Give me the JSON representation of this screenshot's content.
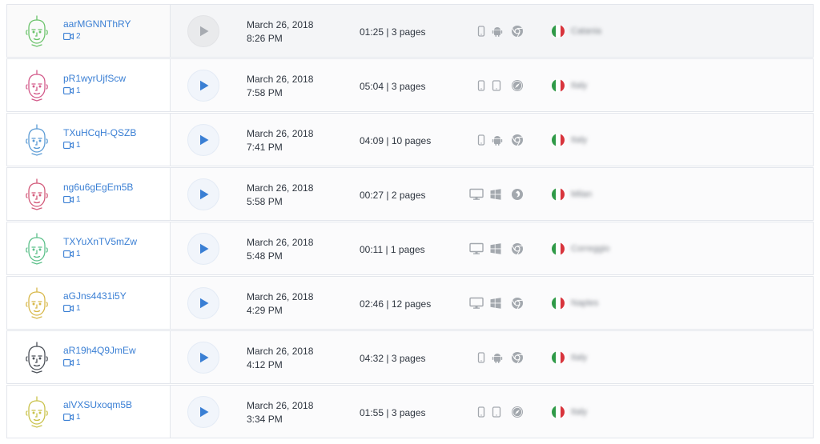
{
  "colors": {
    "link": "#3a7fd4",
    "play_active": "#3a7fd4",
    "play_inactive": "#a7abb1",
    "icon_gray": "#a3a8ae",
    "flag": [
      "#2f9a47",
      "#ffffff",
      "#d8343c"
    ]
  },
  "sessions": [
    {
      "user": "aarMGNNThRY",
      "recordings": "2",
      "date": "March 26, 2018",
      "time": "8:26 PM",
      "duration": "01:25 | 3 pages",
      "device": "mobile",
      "os": "android-icon",
      "browser": "chrome-icon",
      "country": "italy",
      "city": "Catania",
      "avatar_color": "#6bc36b",
      "watched": true
    },
    {
      "user": "pR1wyrUjfScw",
      "recordings": "1",
      "date": "March 26, 2018",
      "time": "7:58 PM",
      "duration": "05:04 | 3 pages",
      "device": "mobile",
      "os": "tablet-icon",
      "browser": "safari-icon",
      "country": "italy",
      "city": "Italy",
      "avatar_color": "#d35a8a",
      "watched": false
    },
    {
      "user": "TXuHCqH-QSZB",
      "recordings": "1",
      "date": "March 26, 2018",
      "time": "7:41 PM",
      "duration": "04:09 | 10 pages",
      "device": "mobile",
      "os": "android-icon",
      "browser": "chrome-icon",
      "country": "italy",
      "city": "Italy",
      "avatar_color": "#5b9bd5",
      "watched": false
    },
    {
      "user": "ng6u6gEgEm5B",
      "recordings": "1",
      "date": "March 26, 2018",
      "time": "5:58 PM",
      "duration": "00:27 | 2 pages",
      "device": "desktop",
      "os": "windows-icon",
      "browser": "firefox-icon",
      "country": "italy",
      "city": "Milan",
      "avatar_color": "#d35a7a",
      "watched": false
    },
    {
      "user": "TXYuXnTV5mZw",
      "recordings": "1",
      "date": "March 26, 2018",
      "time": "5:48 PM",
      "duration": "00:11 | 1 pages",
      "device": "desktop",
      "os": "windows-icon",
      "browser": "chrome-icon",
      "country": "italy",
      "city": "Correggio",
      "avatar_color": "#5cc08a",
      "watched": false
    },
    {
      "user": "aGJns4431i5Y",
      "recordings": "1",
      "date": "March 26, 2018",
      "time": "4:29 PM",
      "duration": "02:46 | 12 pages",
      "device": "desktop",
      "os": "windows-icon",
      "browser": "chrome-icon",
      "country": "italy",
      "city": "Naples",
      "avatar_color": "#d8b84a",
      "watched": false
    },
    {
      "user": "aR19h4Q9JmEw",
      "recordings": "1",
      "date": "March 26, 2018",
      "time": "4:12 PM",
      "duration": "04:32 | 3 pages",
      "device": "mobile",
      "os": "android-icon",
      "browser": "chrome-icon",
      "country": "italy",
      "city": "Italy",
      "avatar_color": "#4a4f57",
      "watched": false
    },
    {
      "user": "alVXSUxoqm5B",
      "recordings": "1",
      "date": "March 26, 2018",
      "time": "3:34 PM",
      "duration": "01:55 | 3 pages",
      "device": "mobile",
      "os": "tablet-icon",
      "browser": "safari-icon",
      "country": "italy",
      "city": "Italy",
      "avatar_color": "#c9c24a",
      "watched": false
    }
  ]
}
